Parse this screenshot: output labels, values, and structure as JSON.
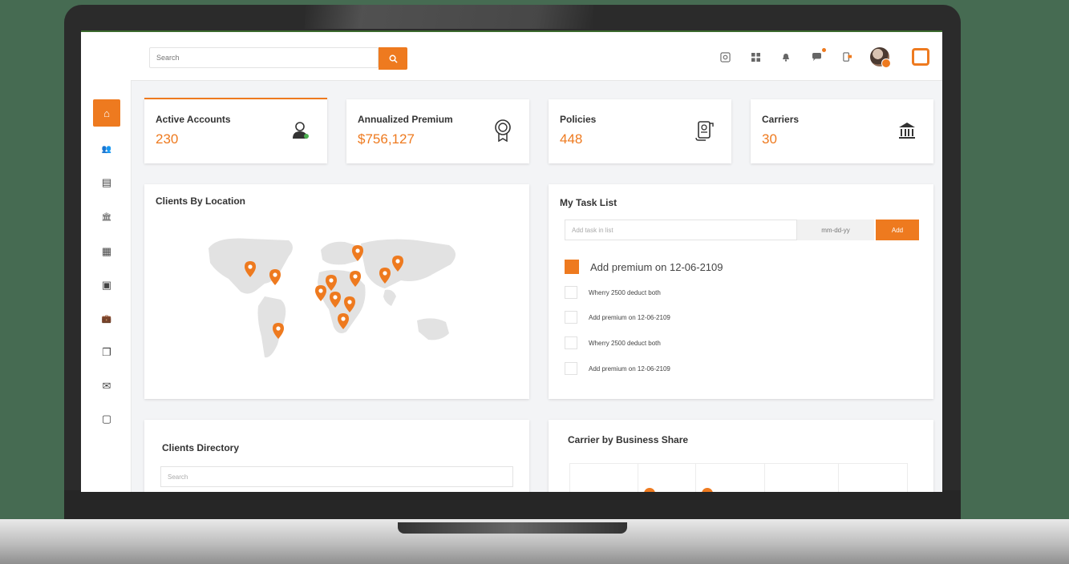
{
  "colors": {
    "accent": "#ee7a1f",
    "background": "#466b52",
    "card": "#ffffff"
  },
  "header": {
    "search_placeholder": "Search",
    "icons": [
      "settings-icon",
      "grid-icon",
      "bell-icon",
      "chat-icon",
      "card-icon",
      "avatar",
      "brand-logo"
    ]
  },
  "sidebar": {
    "items": [
      {
        "icon": "home-icon",
        "glyph": "⌂",
        "active": true
      },
      {
        "icon": "users-icon",
        "glyph": "👥",
        "active": false
      },
      {
        "icon": "document-icon",
        "glyph": "▤",
        "active": false
      },
      {
        "icon": "bank-icon",
        "glyph": "🏛",
        "active": false
      },
      {
        "icon": "calendar-icon",
        "glyph": "▦",
        "active": false
      },
      {
        "icon": "contact-book-icon",
        "glyph": "▣",
        "active": false
      },
      {
        "icon": "briefcase-icon",
        "glyph": "💼",
        "active": false
      },
      {
        "icon": "files-icon",
        "glyph": "❐",
        "active": false
      },
      {
        "icon": "mail-icon",
        "glyph": "✉",
        "active": false
      },
      {
        "icon": "card-icon",
        "glyph": "▢",
        "active": false
      }
    ]
  },
  "stats": [
    {
      "title": "Active Accounts",
      "value": "230",
      "icon": "user-icon"
    },
    {
      "title": "Annualized Premium",
      "value": "$756,127",
      "icon": "award-icon"
    },
    {
      "title": "Policies",
      "value": "448",
      "icon": "policy-scroll-icon"
    },
    {
      "title": "Carriers",
      "value": "30",
      "icon": "bank-icon"
    }
  ],
  "clients_by_location": {
    "title": "Clients By Location"
  },
  "tasks": {
    "title": "My Task List",
    "input_placeholder": "Add task in list",
    "date_placeholder": "mm-dd-yy",
    "add_label": "Add",
    "items": [
      {
        "text": "Add premium on 12-06-2109",
        "checked": true
      },
      {
        "text": "Wherry 2500 deduct both",
        "checked": false
      },
      {
        "text": "Add premium on 12-06-2109",
        "checked": false
      },
      {
        "text": "Wherry 2500 deduct both",
        "checked": false
      },
      {
        "text": "Add premium on 12-06-2109",
        "checked": false
      }
    ]
  },
  "clients_directory": {
    "title": "Clients Directory",
    "search_placeholder": "Search"
  },
  "carrier_share": {
    "title": "Carrier by Business Share"
  }
}
